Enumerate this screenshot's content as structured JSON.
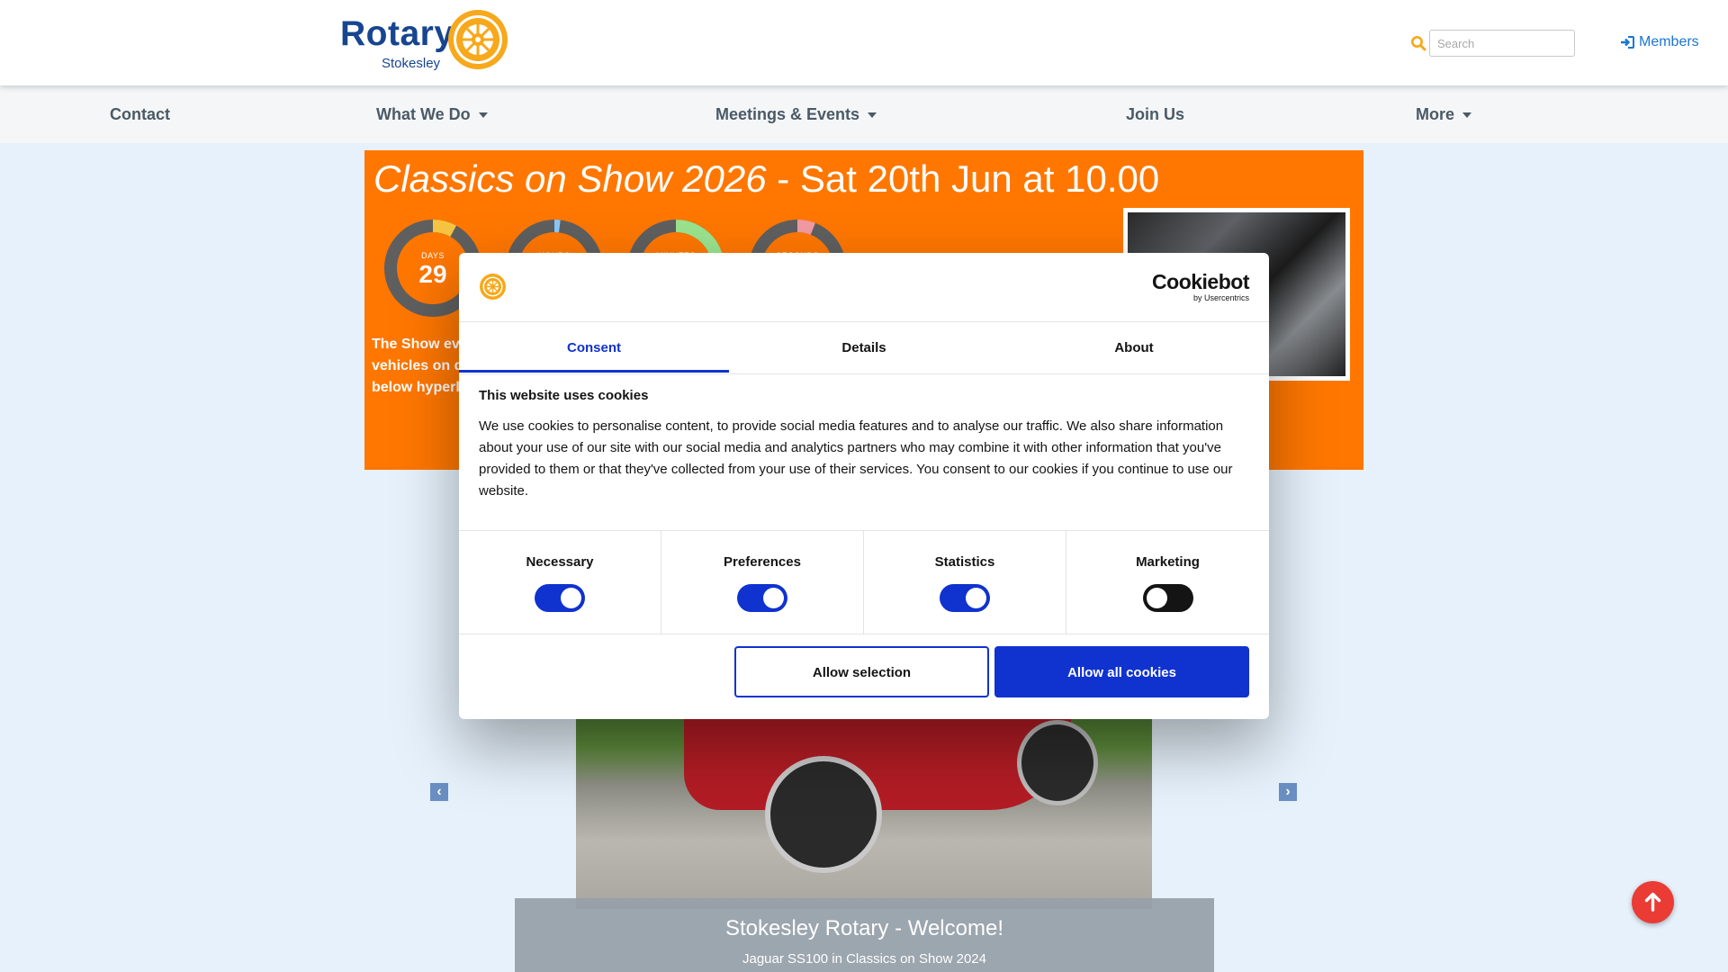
{
  "header": {
    "logo": {
      "word": "Rotary",
      "club": "Stokesley"
    },
    "search": {
      "placeholder": "Search",
      "value": ""
    },
    "members_label": "Members"
  },
  "nav": {
    "items": [
      {
        "label": "Contact",
        "dropdown": false
      },
      {
        "label": "What We Do",
        "dropdown": true
      },
      {
        "label": "Meetings & Events",
        "dropdown": true
      },
      {
        "label": "Join Us",
        "dropdown": false
      },
      {
        "label": "More",
        "dropdown": true
      }
    ]
  },
  "banner": {
    "title_italic": "Classics on Show 2026",
    "title_rest": " - Sat 20th Jun at 10.00",
    "countdown": [
      {
        "unit": "DAYS",
        "value": "29",
        "color": "#f5c542",
        "fraction": 0.08
      },
      {
        "unit": "HOURS",
        "value": "",
        "color": "#8cc7f5",
        "fraction": 0.02
      },
      {
        "unit": "MINUTES",
        "value": "",
        "color": "#9be38f",
        "fraction": 0.2
      },
      {
        "unit": "SECONDS",
        "value": "",
        "color": "#f29aa2",
        "fraction": 0.06
      }
    ],
    "text": "The Show eve vehicles on di below hyperli"
  },
  "carousel": {
    "caption_title": "Stokesley Rotary - Welcome!",
    "caption_sub": "Jaguar SS100 in Classics on Show 2024"
  },
  "cookie_dialog": {
    "brand": "Cookiebot",
    "brand_sub": "by Usercentrics",
    "tabs": [
      "Consent",
      "Details",
      "About"
    ],
    "active_tab": "Consent",
    "heading": "This website uses cookies",
    "body": "We use cookies to personalise content, to provide social media features and to analyse our traffic. We also share information about your use of our site with our social media and analytics partners who may combine it with other information that you've provided to them or that they've collected from your use of their services. You consent to our cookies if you continue to use our website.",
    "toggles": [
      {
        "label": "Necessary",
        "on": true
      },
      {
        "label": "Preferences",
        "on": true
      },
      {
        "label": "Statistics",
        "on": true
      },
      {
        "label": "Marketing",
        "on": false
      }
    ],
    "allow_selection_label": "Allow selection",
    "allow_all_label": "Allow all cookies"
  },
  "colors": {
    "rotary_blue": "#17458f",
    "rotary_gold": "#f7a81b",
    "banner_orange": "#ff7700",
    "cookiebot_blue": "#1032cf",
    "link_blue": "#1976d2",
    "back_to_top": "#ea3b35"
  }
}
